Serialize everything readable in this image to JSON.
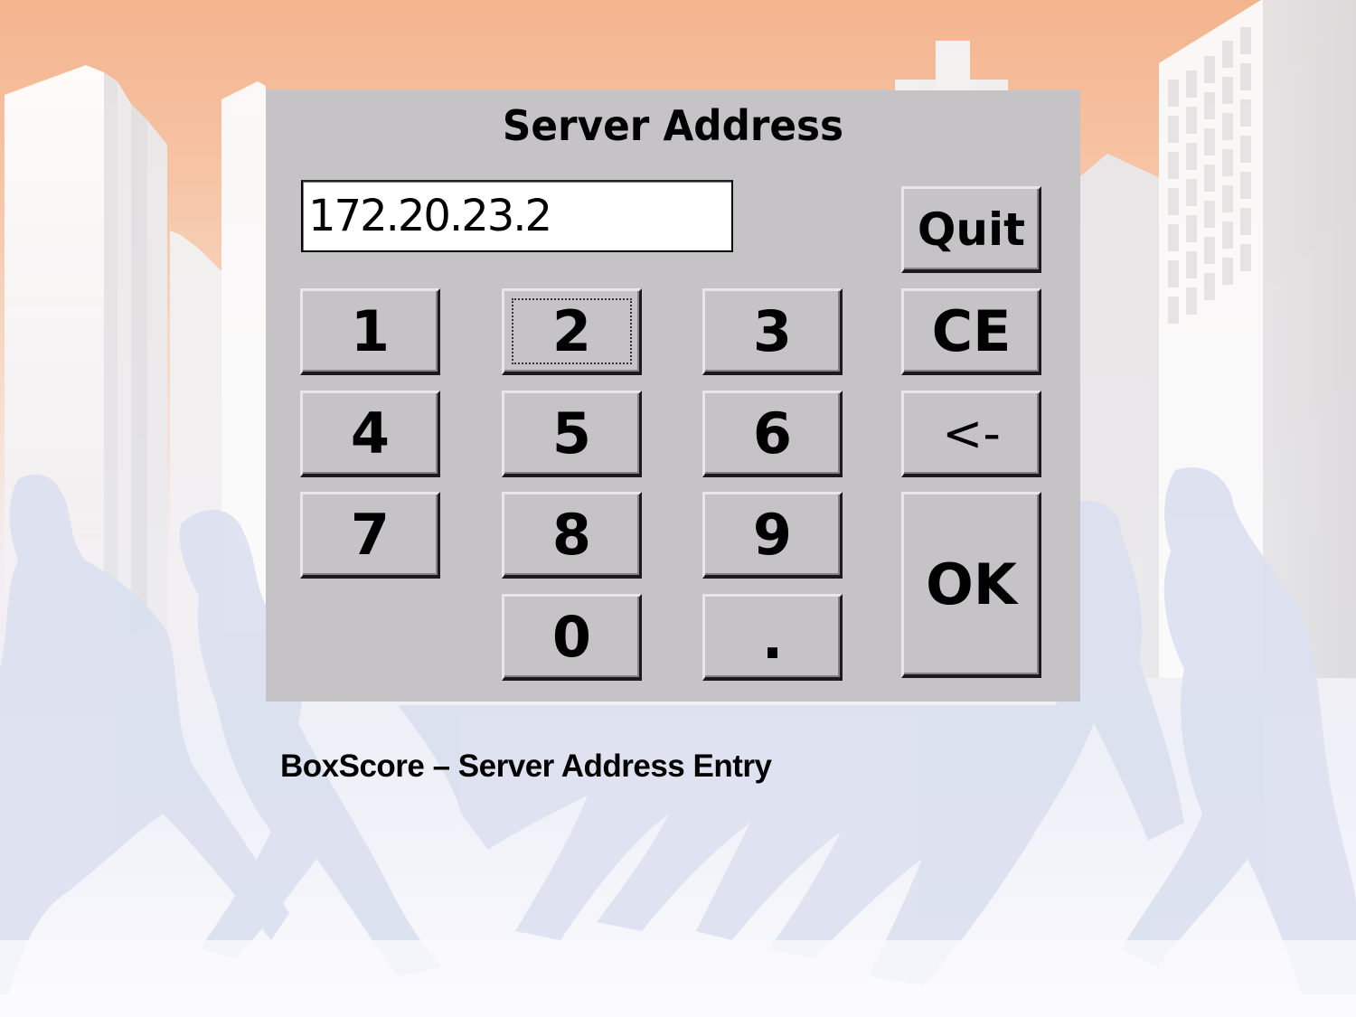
{
  "dialog": {
    "title": "Server Address",
    "address_value": "172.20.23.2",
    "buttons": {
      "quit": "Quit",
      "ce": "CE",
      "backspace": "<-",
      "ok": "OK",
      "k1": "1",
      "k2": "2",
      "k3": "3",
      "k4": "4",
      "k5": "5",
      "k6": "6",
      "k7": "7",
      "k8": "8",
      "k9": "9",
      "k0": "0",
      "dot": "."
    },
    "focused_key": "2"
  },
  "caption": "BoxScore – Server Address Entry",
  "colors": {
    "dialog_bg": "#c5c3c6",
    "sky_top": "#f4b48e",
    "silhouette": "#dfe3f1"
  }
}
